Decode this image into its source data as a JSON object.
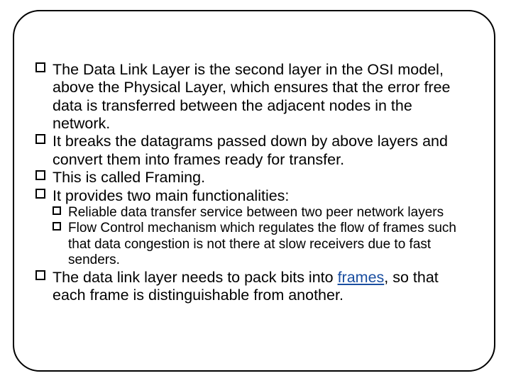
{
  "bullets": {
    "b1": "The Data Link Layer is the second layer in the OSI model, above the Physical Layer, which ensures that the error free data is transferred between the adjacent nodes in the network.",
    "b2": "It breaks the datagrams passed down by above layers and convert them into frames ready for transfer.",
    "b3": "This is called Framing.",
    "b4": "It provides two main functionalities:",
    "s1": "Reliable data transfer service between two peer network layers",
    "s2": "Flow Control mechanism which regulates the flow of frames such that data congestion is not there at slow receivers due to fast senders.",
    "b5_pre": "The data link layer needs to pack bits into ",
    "b5_link": "frames",
    "b5_post": ", so that each frame is distinguishable from another."
  }
}
